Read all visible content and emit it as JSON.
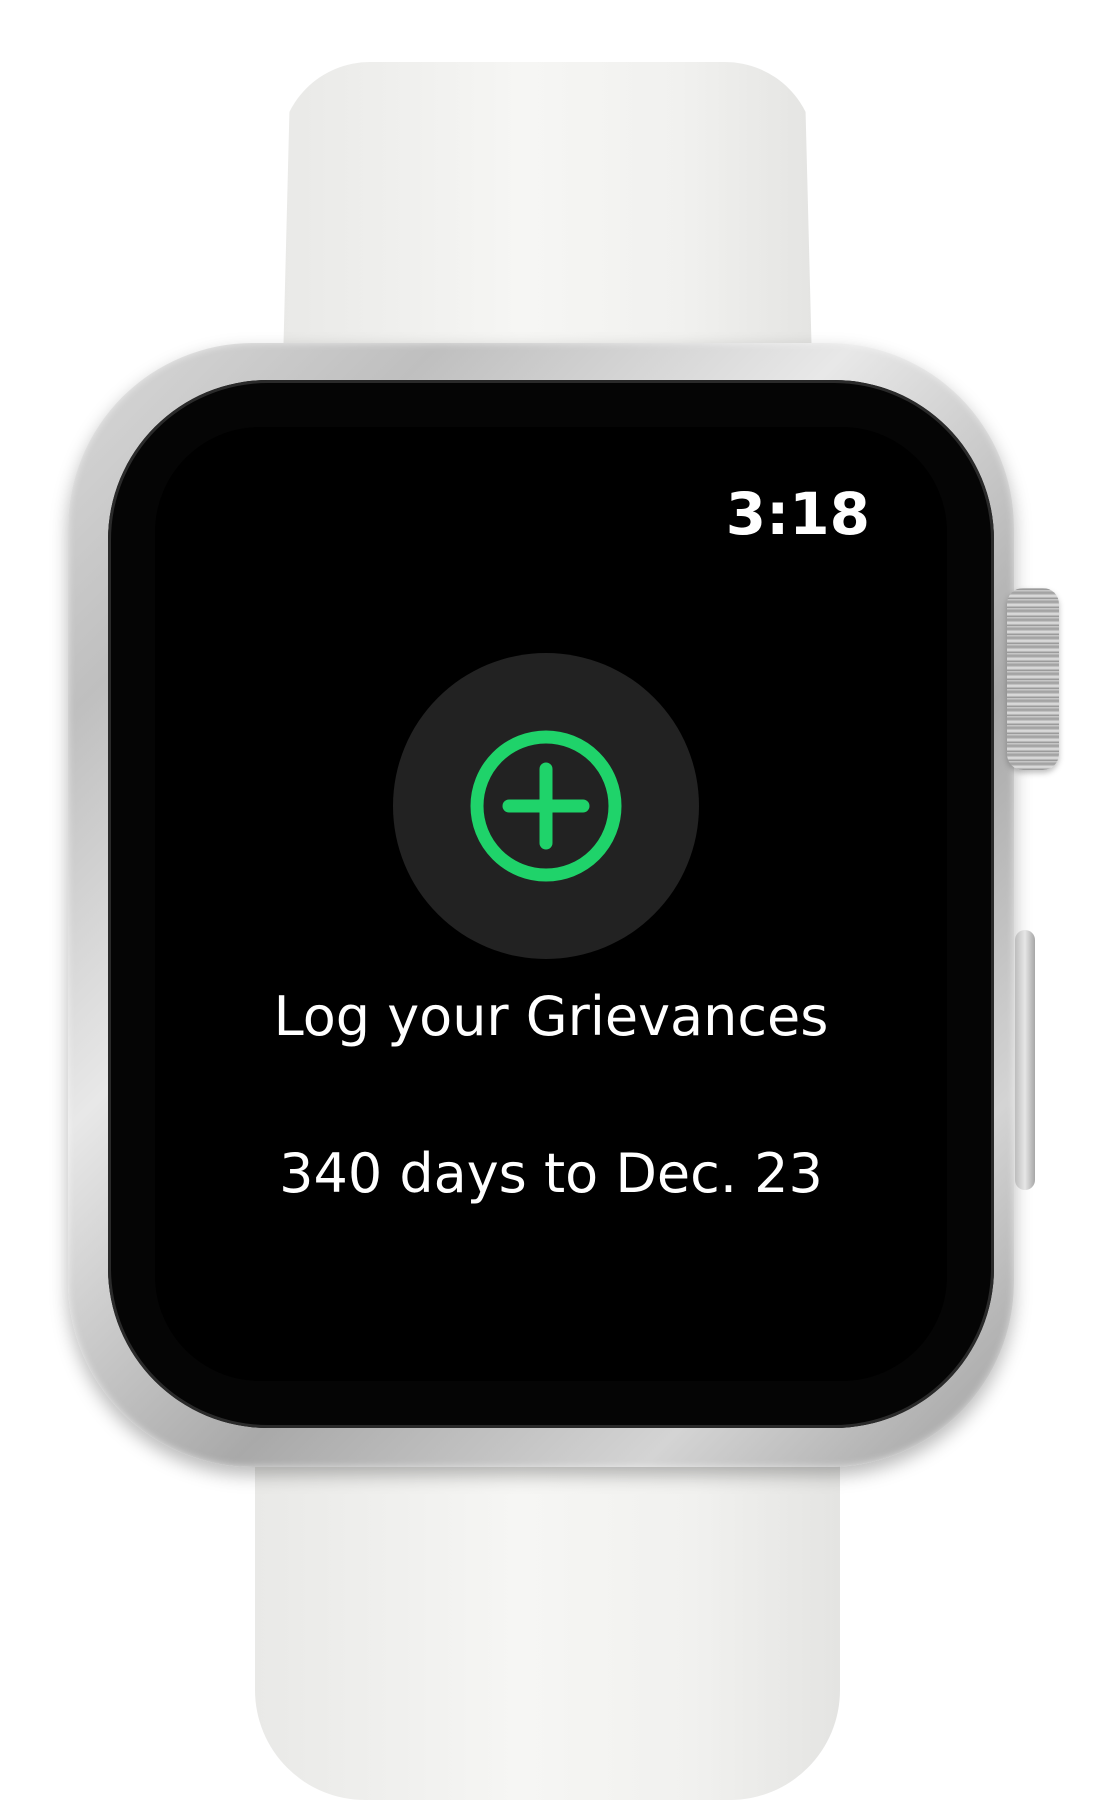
{
  "watch": {
    "time": "3:18",
    "accent_color": "#1fd36a"
  },
  "main": {
    "add_icon": "plus-circle-icon",
    "title": "Log your Grievances",
    "countdown": "340 days to Dec. 23"
  }
}
